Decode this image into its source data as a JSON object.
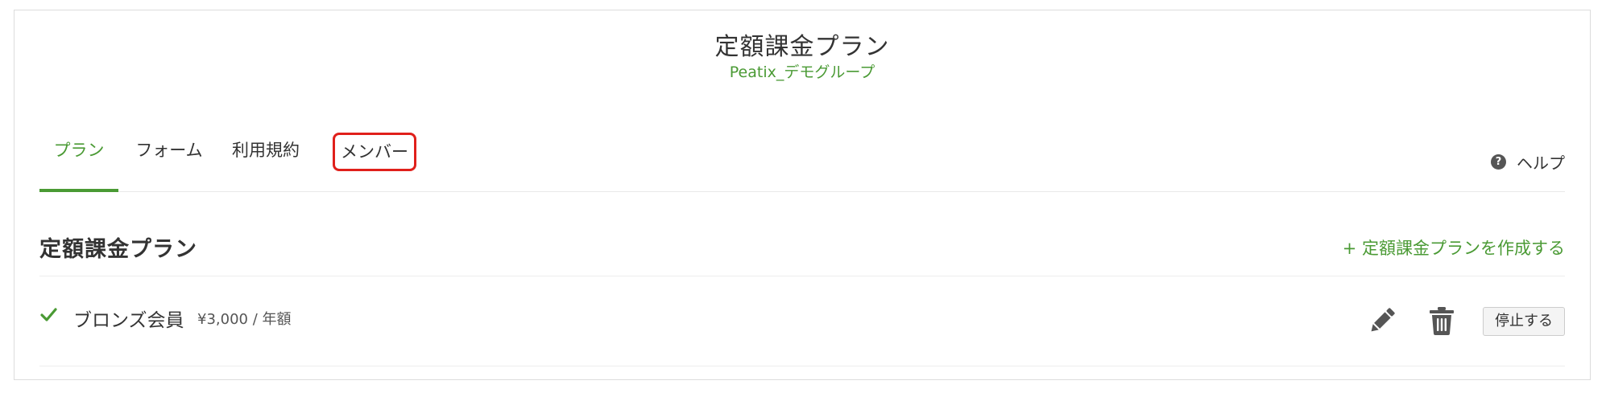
{
  "header": {
    "title": "定額課金プラン",
    "subtitle": "Peatix_デモグループ"
  },
  "tabs": [
    {
      "label": "プラン",
      "active": true
    },
    {
      "label": "フォーム",
      "active": false
    },
    {
      "label": "利用規約",
      "active": false
    },
    {
      "label": "メンバー",
      "active": false,
      "highlighted": true
    }
  ],
  "help": {
    "label": "ヘルプ",
    "icon": "question-circle-icon"
  },
  "section": {
    "title": "定額課金プラン",
    "create_link": "+ 定額課金プランを作成する"
  },
  "plans": [
    {
      "status_icon": "check-icon",
      "name": "ブロンズ会員",
      "price": "¥3,000 / 年額",
      "stop_label": "停止する"
    }
  ],
  "colors": {
    "accent": "#4a9a34",
    "highlight_border": "#e0201b",
    "icon_gray": "#555555"
  }
}
